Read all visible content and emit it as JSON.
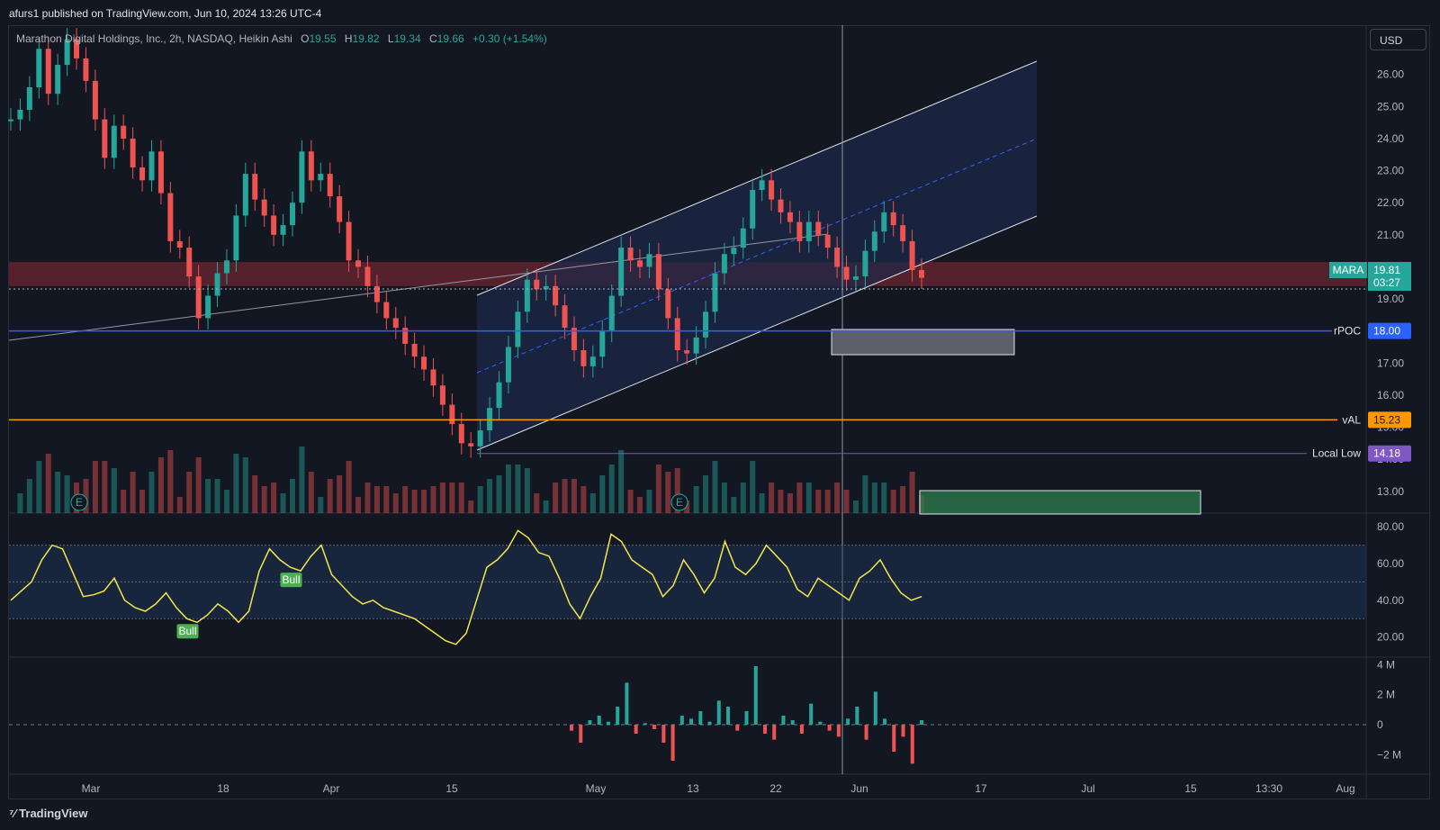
{
  "header": {
    "published": "afurs1 published on TradingView.com, Jun 10, 2024 13:26 UTC-4",
    "currency": "USD",
    "branding": "TradingView"
  },
  "legend": {
    "title": "Marathon Digital Holdings, Inc., 2h, NASDAQ, Heikin Ashi",
    "o_label": "O",
    "o": "19.55",
    "h_label": "H",
    "h": "19.82",
    "l_label": "L",
    "l": "19.34",
    "c_label": "C",
    "c": "19.66",
    "change": "+0.30 (+1.54%)"
  },
  "colors": {
    "up": "#26a69a",
    "down": "#ef5350",
    "rsi": "#f4e64a",
    "rpoc": "#2962ff",
    "val": "#ff9800",
    "local_low": "#7e57c2",
    "resistance_zone": "#8c2a35",
    "channel": "#1e2a4a"
  },
  "chart_data": [
    {
      "type": "candlestick",
      "symbol": "MARA",
      "interval": "2h",
      "chart_style": "Heikin Ashi",
      "y_ticks": [
        "26.00",
        "25.00",
        "24.00",
        "23.00",
        "22.00",
        "21.00",
        "20.00",
        "19.00",
        "18.00",
        "17.00",
        "16.00",
        "15.00",
        "14.00",
        "13.00"
      ],
      "ylim": [
        12.6,
        27.2
      ],
      "x_ticks": [
        "Mar",
        "18",
        "Apr",
        "15",
        "May",
        "13",
        "22",
        "Jun",
        "17",
        "Jul",
        "15",
        "13:30",
        "Aug"
      ],
      "close_series": [
        24.6,
        24.9,
        25.6,
        26.8,
        25.4,
        26.3,
        27.1,
        26.5,
        25.8,
        24.6,
        23.4,
        24.4,
        24.0,
        23.1,
        22.7,
        23.6,
        22.3,
        20.8,
        20.6,
        19.7,
        18.4,
        19.1,
        19.8,
        20.2,
        21.6,
        22.9,
        22.1,
        21.6,
        21.0,
        21.3,
        22.0,
        23.6,
        22.7,
        22.9,
        22.2,
        21.4,
        20.2,
        20.0,
        19.4,
        18.9,
        18.4,
        18.1,
        17.6,
        17.2,
        16.8,
        16.3,
        15.7,
        15.1,
        14.5,
        14.4,
        14.9,
        15.6,
        16.4,
        17.5,
        18.6,
        19.6,
        19.3,
        19.4,
        18.8,
        18.1,
        17.4,
        16.9,
        17.2,
        18.0,
        19.1,
        20.6,
        20.2,
        20.0,
        20.4,
        19.3,
        18.4,
        17.4,
        17.3,
        17.8,
        18.6,
        19.8,
        20.4,
        20.6,
        21.2,
        22.4,
        22.7,
        22.1,
        21.7,
        21.4,
        20.8,
        21.4,
        21.0,
        20.6,
        20.0,
        19.6,
        19.7,
        20.5,
        21.1,
        21.7,
        21.3,
        20.8,
        19.9,
        19.66
      ],
      "overlays": {
        "horizontal_lines": [
          {
            "label": "rPOC",
            "value": 18.0
          },
          {
            "label": "vAL",
            "value": 15.23
          },
          {
            "label": "Local Low",
            "value": 14.18
          }
        ],
        "last_price": {
          "symbol": "MARA",
          "value": "19.81",
          "countdown": "03:27"
        },
        "resistance_zone": [
          19.4,
          20.15
        ]
      }
    },
    {
      "type": "line",
      "name": "RSI",
      "y_ticks": [
        "80.00",
        "60.00",
        "40.00",
        "20.00"
      ],
      "ylim": [
        10,
        85
      ],
      "band": [
        30,
        70
      ],
      "values": [
        40,
        45,
        50,
        62,
        70,
        68,
        55,
        42,
        43,
        45,
        52,
        40,
        36,
        34,
        38,
        44,
        36,
        30,
        28,
        32,
        38,
        34,
        28,
        34,
        56,
        68,
        62,
        58,
        56,
        64,
        70,
        54,
        48,
        42,
        38,
        40,
        36,
        34,
        32,
        30,
        26,
        22,
        18,
        16,
        22,
        40,
        58,
        62,
        68,
        78,
        74,
        66,
        64,
        52,
        38,
        30,
        42,
        52,
        76,
        72,
        62,
        58,
        54,
        42,
        48,
        62,
        54,
        44,
        52,
        72,
        58,
        54,
        60,
        70,
        64,
        58,
        46,
        42,
        52,
        48,
        44,
        40,
        52,
        56,
        62,
        52,
        44,
        40,
        42
      ],
      "signals": [
        "Bull",
        "Bull"
      ]
    },
    {
      "type": "bar",
      "name": "Oscillator",
      "y_ticks": [
        "4 M",
        "2 M",
        "0",
        "−2 M"
      ],
      "ylim": [
        -3,
        4.2
      ],
      "values": [
        -0.4,
        -1.2,
        0.3,
        0.6,
        0.2,
        1.2,
        2.8,
        -0.6,
        0.1,
        -0.3,
        -1.2,
        -2.4,
        0.6,
        0.4,
        0.9,
        0.2,
        1.6,
        1.2,
        -0.4,
        0.9,
        3.9,
        -0.6,
        -1.0,
        0.6,
        0.3,
        -0.6,
        1.4,
        0.2,
        -0.4,
        -0.8,
        0.4,
        1.2,
        -1.0,
        2.2,
        0.4,
        -1.8,
        -0.8,
        -2.6,
        0.3
      ]
    }
  ]
}
